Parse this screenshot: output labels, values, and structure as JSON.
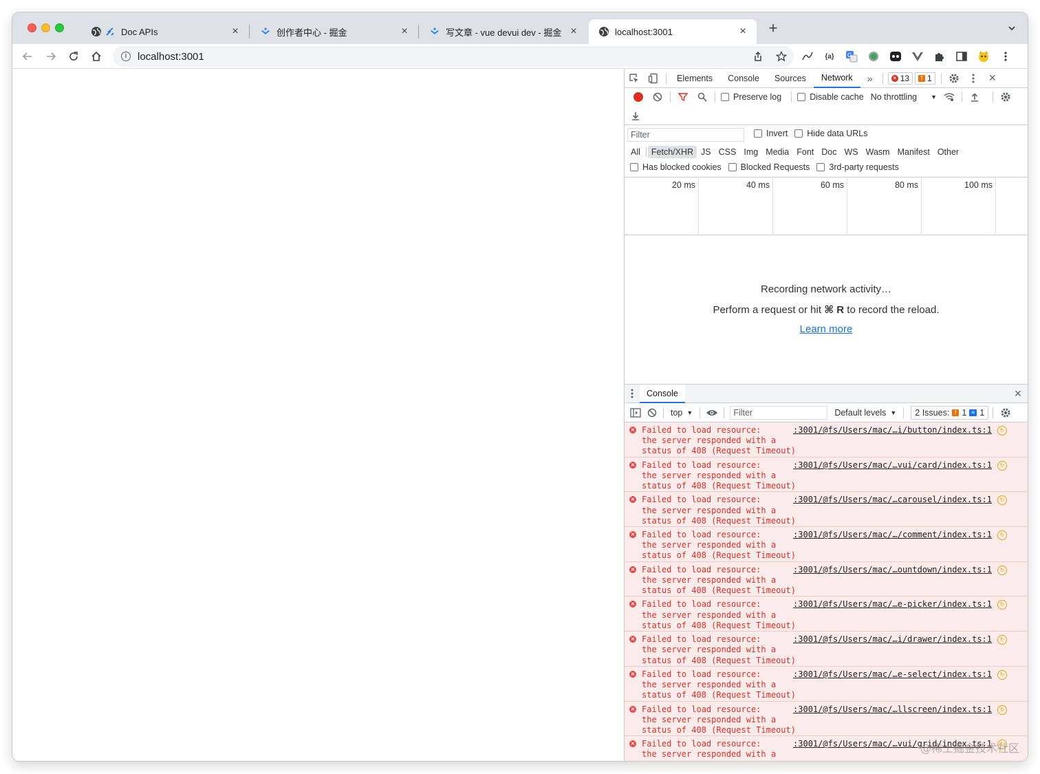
{
  "tabs": [
    {
      "title": "Doc APIs",
      "active": false
    },
    {
      "title": "创作者中心 - 掘金",
      "active": false
    },
    {
      "title": "写文章 - vue devui dev - 掘金",
      "active": false
    },
    {
      "title": "localhost:3001",
      "active": true
    }
  ],
  "new_tab_label": "+",
  "address": {
    "url": "localhost:3001"
  },
  "devtools": {
    "tabs": [
      "Elements",
      "Console",
      "Sources",
      "Network"
    ],
    "active_tab": "Network",
    "more_label": "»",
    "error_count": "13",
    "warning_count": "1",
    "network": {
      "preserve_log": "Preserve log",
      "disable_cache": "Disable cache",
      "throttling": "No throttling",
      "filter_placeholder": "Filter",
      "invert": "Invert",
      "hide_data_urls": "Hide data URLs",
      "types": [
        "All",
        "Fetch/XHR",
        "JS",
        "CSS",
        "Img",
        "Media",
        "Font",
        "Doc",
        "WS",
        "Wasm",
        "Manifest",
        "Other"
      ],
      "active_type": "Fetch/XHR",
      "has_blocked_cookies": "Has blocked cookies",
      "blocked_requests": "Blocked Requests",
      "third_party": "3rd-party requests",
      "timeline_ticks": [
        "20 ms",
        "40 ms",
        "60 ms",
        "80 ms",
        "100 ms"
      ],
      "empty_title": "Recording network activity…",
      "empty_hint_before": "Perform a request or hit ",
      "empty_hint_key": "⌘ R",
      "empty_hint_after": " to record the reload.",
      "learn_more": "Learn more"
    },
    "drawer": {
      "tab": "Console",
      "context": "top",
      "filter_placeholder": "Filter",
      "levels": "Default levels",
      "issues_label": "2 Issues:",
      "issues_warn": "1",
      "issues_info": "1",
      "messages": [
        {
          "text": "Failed to load resource:\nthe server responded with a\nstatus of 408 (Request Timeout)",
          "source": ":3001/@fs/Users/mac/…i/button/index.ts:1"
        },
        {
          "text": "Failed to load resource:\nthe server responded with a\nstatus of 408 (Request Timeout)",
          "source": ":3001/@fs/Users/mac/…vui/card/index.ts:1"
        },
        {
          "text": "Failed to load resource:\nthe server responded with a\nstatus of 408 (Request Timeout)",
          "source": ":3001/@fs/Users/mac/…carousel/index.ts:1"
        },
        {
          "text": "Failed to load resource:\nthe server responded with a\nstatus of 408 (Request Timeout)",
          "source": ":3001/@fs/Users/mac/…/comment/index.ts:1"
        },
        {
          "text": "Failed to load resource:\nthe server responded with a\nstatus of 408 (Request Timeout)",
          "source": ":3001/@fs/Users/mac/…ountdown/index.ts:1"
        },
        {
          "text": "Failed to load resource:\nthe server responded with a\nstatus of 408 (Request Timeout)",
          "source": ":3001/@fs/Users/mac/…e-picker/index.ts:1"
        },
        {
          "text": "Failed to load resource:\nthe server responded with a\nstatus of 408 (Request Timeout)",
          "source": ":3001/@fs/Users/mac/…i/drawer/index.ts:1"
        },
        {
          "text": "Failed to load resource:\nthe server responded with a\nstatus of 408 (Request Timeout)",
          "source": ":3001/@fs/Users/mac/…e-select/index.ts:1"
        },
        {
          "text": "Failed to load resource:\nthe server responded with a\nstatus of 408 (Request Timeout)",
          "source": ":3001/@fs/Users/mac/…llscreen/index.ts:1"
        },
        {
          "text": "Failed to load resource:\nthe server responded with a",
          "source": ":3001/@fs/Users/mac/…vui/grid/index.ts:1"
        }
      ]
    }
  },
  "watermark": "@稀土掘金技术社区",
  "colors": {
    "error": "#d93025",
    "warning": "#e8710a",
    "accent": "#1a73e8",
    "error_bg": "#fcebeb"
  }
}
